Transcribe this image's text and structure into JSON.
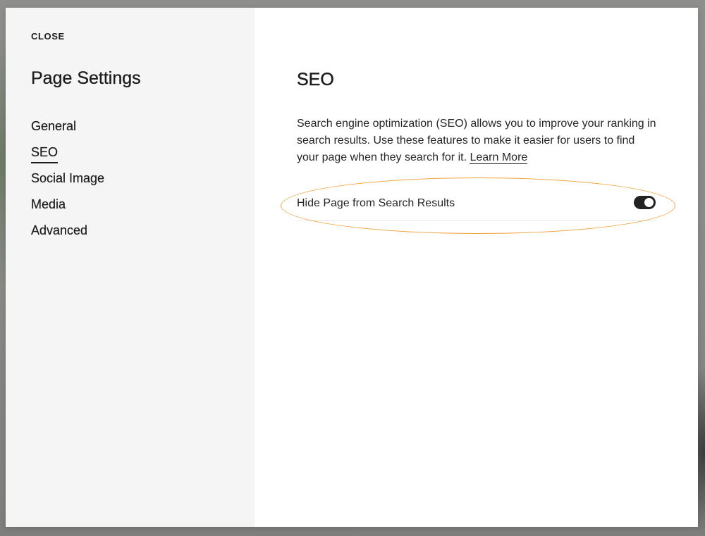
{
  "sidebar": {
    "close_label": "CLOSE",
    "title": "Page Settings",
    "items": [
      {
        "label": "General",
        "active": false
      },
      {
        "label": "SEO",
        "active": true
      },
      {
        "label": "Social Image",
        "active": false
      },
      {
        "label": "Media",
        "active": false
      },
      {
        "label": "Advanced",
        "active": false
      }
    ]
  },
  "main": {
    "title": "SEO",
    "description": "Search engine optimization (SEO) allows you to improve your ranking in search results. Use these features to make it easier for users to find your page when they search for it.",
    "learn_more_label": "Learn More",
    "settings": [
      {
        "label": "Hide Page from Search Results",
        "enabled": true
      }
    ]
  },
  "colors": {
    "highlight": "#f0a23c",
    "sidebar_bg": "#f5f5f5",
    "toggle_on": "#222222"
  }
}
